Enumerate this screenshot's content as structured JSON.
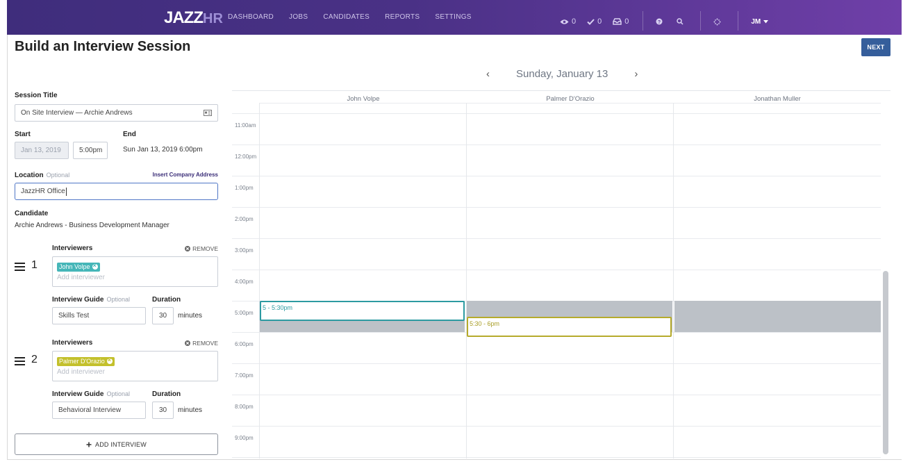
{
  "nav": {
    "logo_main": "JAZZ",
    "logo_accent": "HR",
    "menu": [
      "DASHBOARD",
      "JOBS",
      "CANDIDATES",
      "REPORTS",
      "SETTINGS"
    ],
    "stats": {
      "views": "0",
      "checks": "0",
      "inbox": "0"
    },
    "user_initials": "JM"
  },
  "page": {
    "title": "Build an Interview Session",
    "next_label": "NEXT"
  },
  "form": {
    "session_title_label": "Session Title",
    "session_title_value": "On Site Interview — Archie Andrews",
    "start_label": "Start",
    "end_label": "End",
    "start_date": "Jan 13, 2019",
    "start_time": "5:00pm",
    "end_value": "Sun Jan 13, 2019 6:00pm",
    "location_label": "Location",
    "optional": "Optional",
    "insert_address": "Insert Company Address",
    "location_value": "JazzHR Office",
    "candidate_label": "Candidate",
    "candidate_value": "Archie Andrews - Business Development Manager",
    "interviewers_label": "Interviewers",
    "remove_label": "REMOVE",
    "add_interviewer_placeholder": "Add interviewer",
    "guide_label": "Interview Guide",
    "duration_label": "Duration",
    "minutes_label": "minutes",
    "add_interview_label": "ADD INTERVIEW",
    "interviews": [
      {
        "number": "1",
        "interviewer": "John Volpe",
        "chip_color": "#45b6b8",
        "guide": "Skills Test",
        "duration": "30"
      },
      {
        "number": "2",
        "interviewer": "Palmer D'Orazio",
        "chip_color": "#c3c02c",
        "guide": "Behavioral Interview",
        "duration": "30"
      }
    ]
  },
  "calendar": {
    "date": "Sunday, January 13",
    "prev": "‹",
    "next": "›",
    "columns": [
      "John Volpe",
      "Palmer D'Orazio",
      "Jonathan Muller"
    ],
    "hours": [
      "11:00am",
      "12:00pm",
      "1:00pm",
      "2:00pm",
      "3:00pm",
      "4:00pm",
      "5:00pm",
      "6:00pm",
      "7:00pm",
      "8:00pm",
      "9:00pm"
    ],
    "events": [
      {
        "label": "5 - 5:30pm",
        "color": "#2c9aa1"
      },
      {
        "label": "5:30 - 6pm",
        "color": "#b6ab2b"
      }
    ],
    "busy_color": "#bcc1c7"
  }
}
